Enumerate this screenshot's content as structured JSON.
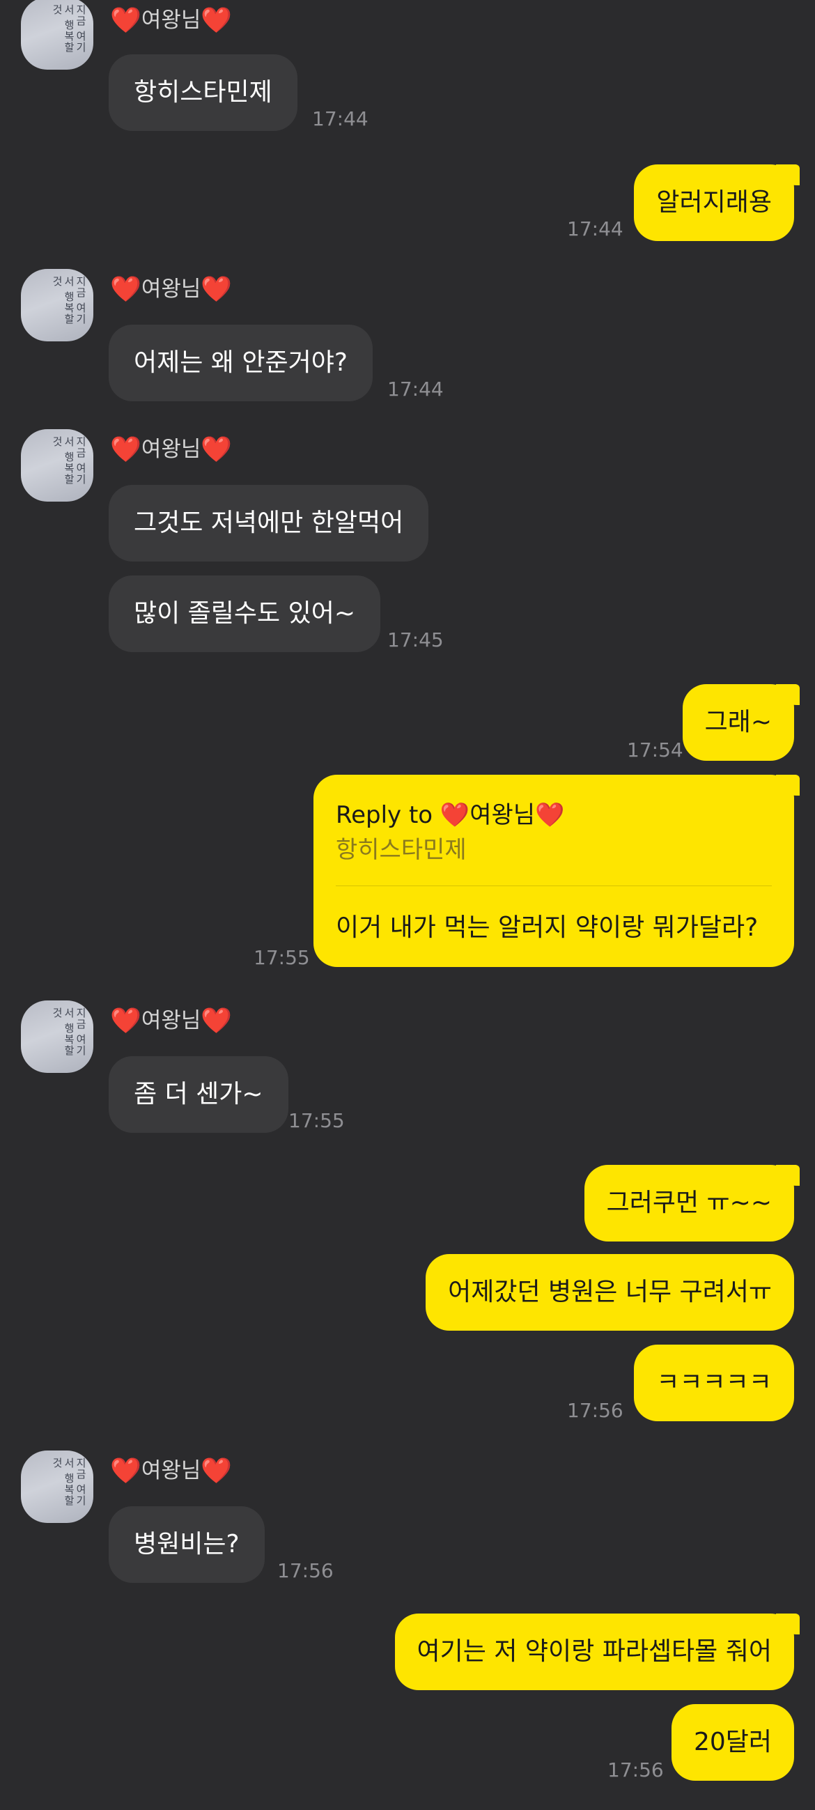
{
  "contact": {
    "name": "여왕님",
    "heart": "❤️",
    "avatar_text": "지금 여기서 행복할 것"
  },
  "messages": [
    {
      "text": "항히스타민제",
      "time": "17:44"
    },
    {
      "text": "알러지래용",
      "time": "17:44"
    },
    {
      "text": "어제는 왜 안준거야?",
      "time": "17:44"
    },
    {
      "text": "그것도 저녁에만 한알먹어"
    },
    {
      "text": "많이 졸릴수도 있어~",
      "time": "17:45"
    },
    {
      "text": "그래~",
      "time": "17:54"
    },
    {
      "reply_to_label": "Reply to",
      "quoted": "항히스타민제",
      "text": "이거 내가 먹는 알러지 약이랑 뭐가달라?",
      "time": "17:55"
    },
    {
      "text": "좀 더 센가~",
      "time": "17:55"
    },
    {
      "text": "그러쿠먼 ㅠ~~"
    },
    {
      "text": "어제갔던 병원은 너무 구려서ㅠ"
    },
    {
      "text": "ㅋㅋㅋㅋㅋ",
      "time": "17:56"
    },
    {
      "text": "병원비는?",
      "time": "17:56"
    },
    {
      "text": "여기는 저 약이랑 파라셉타몰 줘어"
    },
    {
      "text": "20달러",
      "time": "17:56"
    }
  ],
  "colors": {
    "background": "#2b2b2d",
    "incoming_bubble": "#3a3a3c",
    "outgoing_bubble": "#fee500",
    "heart": "#e8141e"
  }
}
